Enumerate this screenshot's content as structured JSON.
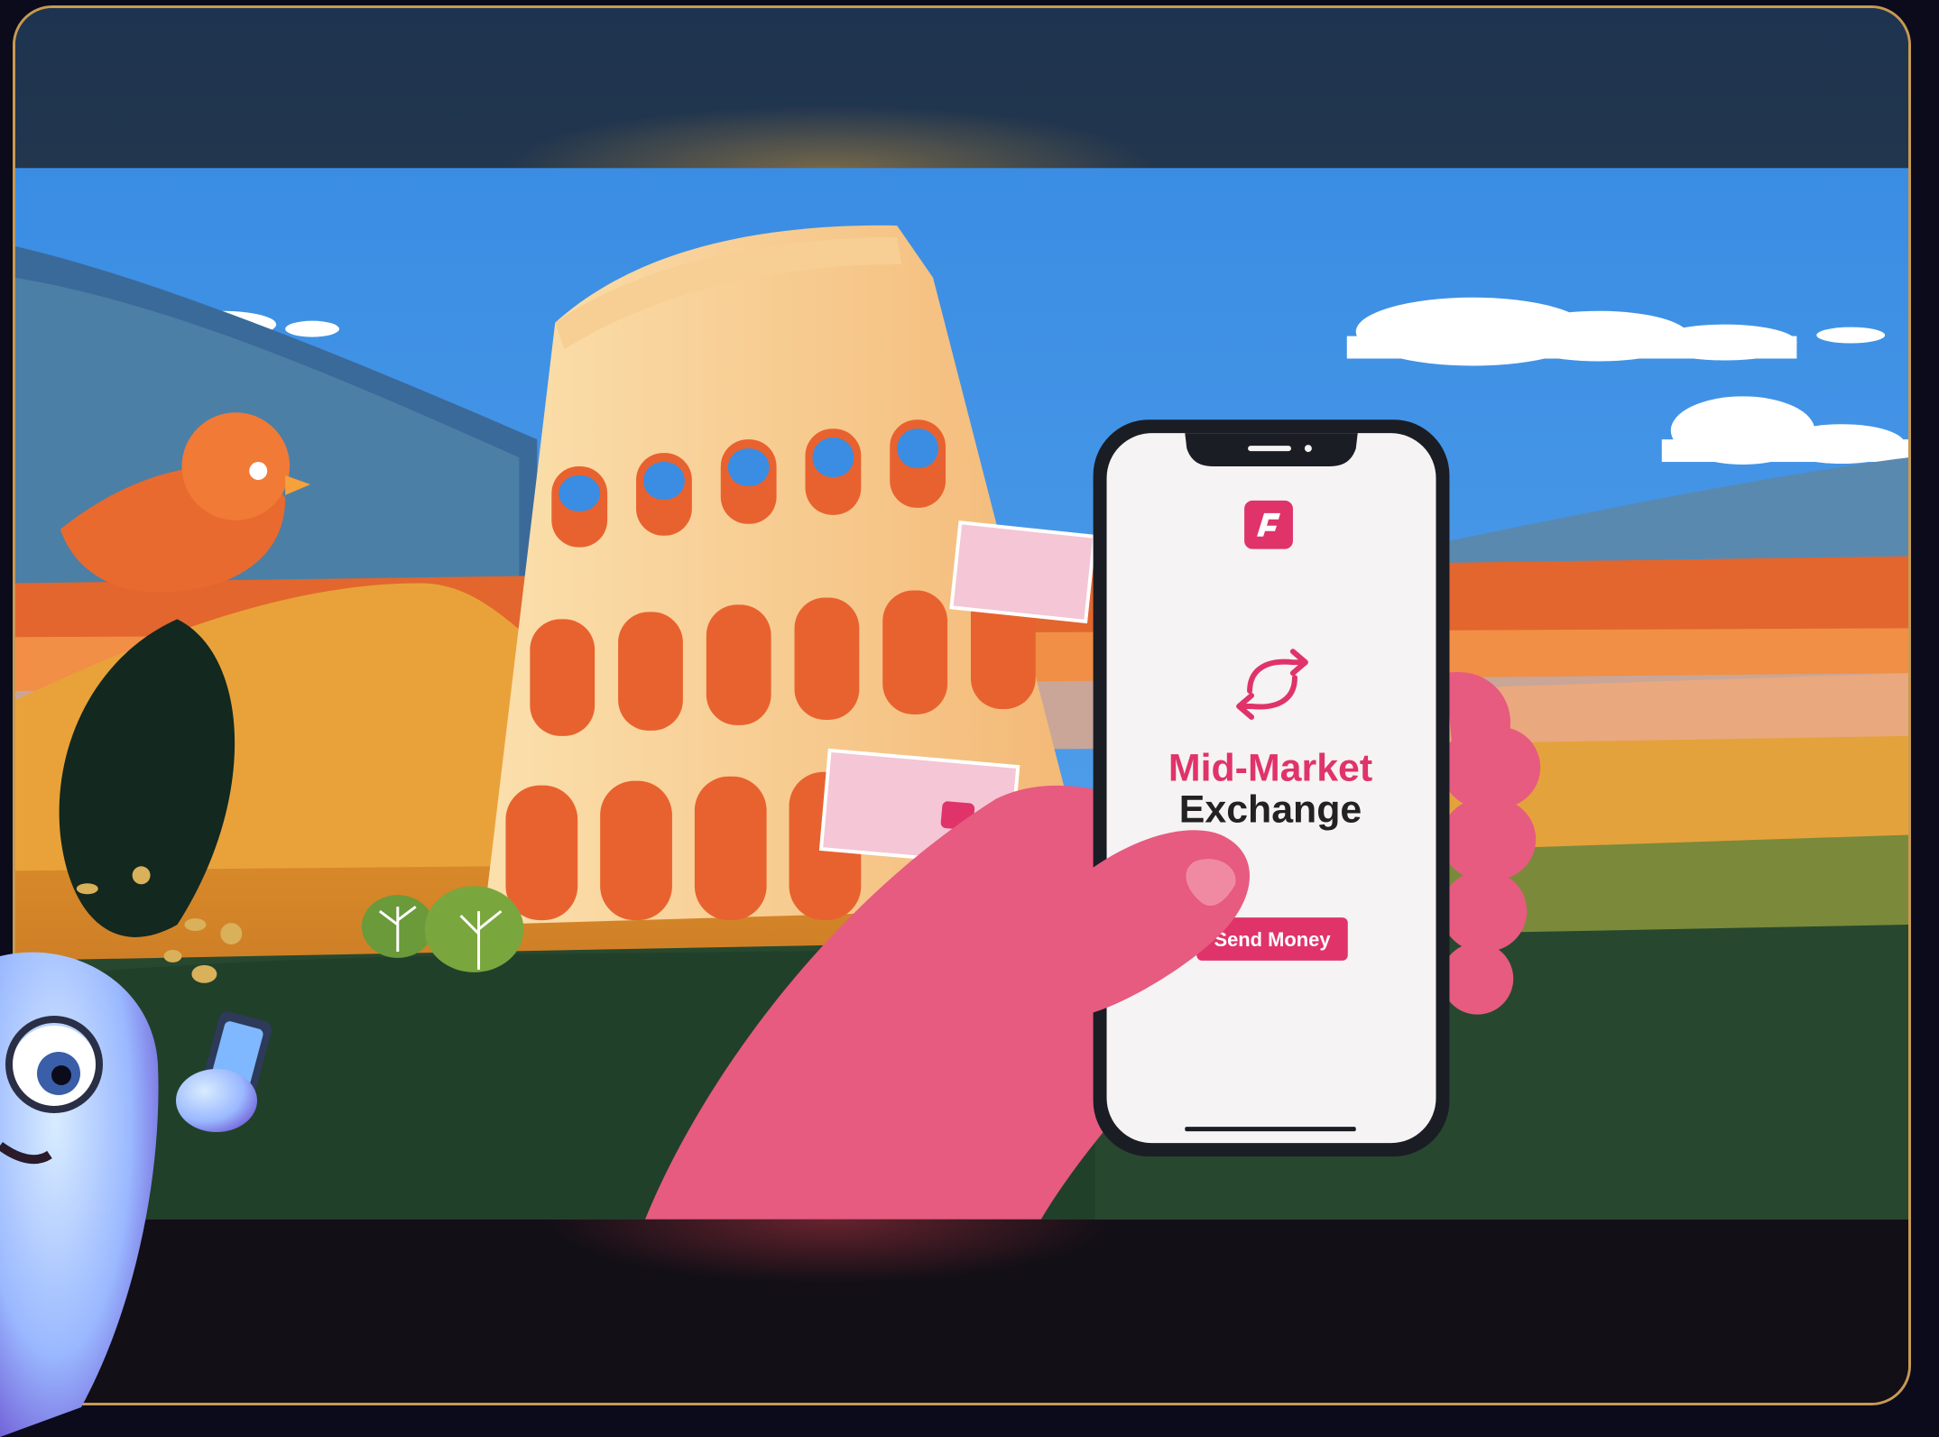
{
  "phone_screen": {
    "title_line1": "Mid-Market",
    "title_line2": "Exchange",
    "button_label": "Send Money"
  },
  "colors": {
    "frame_border": "#c79a52",
    "brand_pink": "#e0336a",
    "sky_blue": "#3f8fe0",
    "colosseum": "#f6c987"
  },
  "icons": [
    "app-logo-icon",
    "exchange-arrows-icon"
  ]
}
